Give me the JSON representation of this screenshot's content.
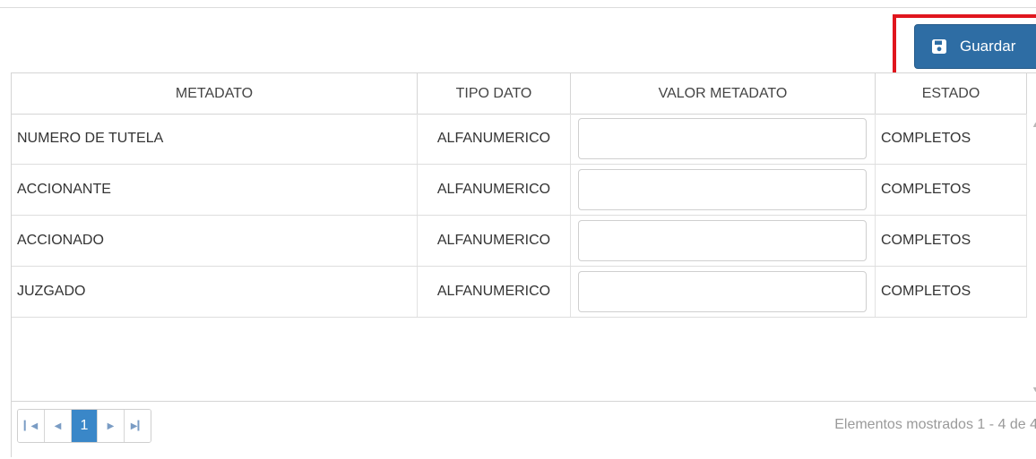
{
  "toolbar": {
    "save_label": "Guardar",
    "save_icon": "floppy-disk-icon",
    "highlight_color": "#e0161e",
    "button_color": "#2e6da4"
  },
  "table": {
    "columns": [
      "METADATO",
      "TIPO DATO",
      "VALOR METADATO",
      "ESTADO"
    ],
    "rows": [
      {
        "metadato": "NUMERO DE TUTELA",
        "tipo": "ALFANUMERICO",
        "valor": "",
        "estado": "COMPLETOS"
      },
      {
        "metadato": "ACCIONANTE",
        "tipo": "ALFANUMERICO",
        "valor": "",
        "estado": "COMPLETOS"
      },
      {
        "metadato": "ACCIONADO",
        "tipo": "ALFANUMERICO",
        "valor": "",
        "estado": "COMPLETOS"
      },
      {
        "metadato": "JUZGADO",
        "tipo": "ALFANUMERICO",
        "valor": "",
        "estado": "COMPLETOS"
      }
    ]
  },
  "pager": {
    "first_icon": "first-page-icon",
    "prev_icon": "prev-page-icon",
    "current_page": "1",
    "next_icon": "next-page-icon",
    "last_icon": "last-page-icon",
    "info": "Elementos mostrados 1 - 4 de 4"
  }
}
